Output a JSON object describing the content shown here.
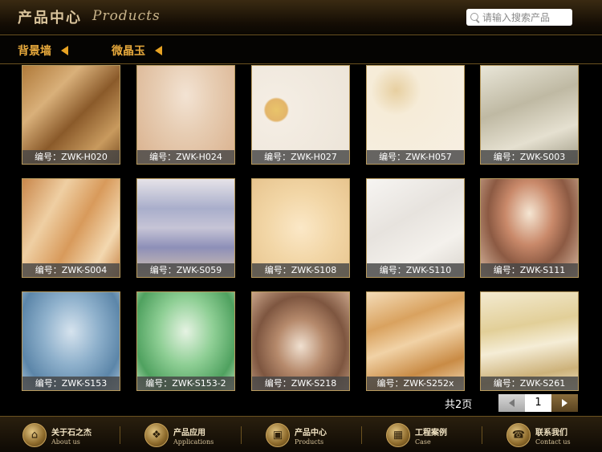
{
  "header": {
    "title_cn": "产品中心",
    "title_en": "Products",
    "search_placeholder": "请输入搜索产品"
  },
  "subnav": {
    "items": [
      {
        "label": "背景墙"
      },
      {
        "label": "微晶玉"
      }
    ]
  },
  "products": [
    {
      "code": "编号：ZWK-H020",
      "bg": "linear-gradient(135deg,#b07a3a 0%,#d9b07a 30%,#8a5a2a 55%,#c89a5e 80%,#7a4e22 100%)"
    },
    {
      "code": "编号：ZWK-H024",
      "bg": "radial-gradient(ellipse at 50% 30%,#f3e3d3 0%,#e7cdb3 40%,#d9b08c 100%)"
    },
    {
      "code": "编号：ZWK-H027",
      "bg": "radial-gradient(circle at 25% 45%,#e9c46a 0%,#e3b56a 12%,#f4ede3 14%,#ece4d8 100%)"
    },
    {
      "code": "编号：ZWK-H057",
      "bg": "radial-gradient(circle at 30% 25%,#e7cfa0 0%,#f6ecd8 25%,#f7efe3 100%)"
    },
    {
      "code": "编号：ZWK-S003",
      "bg": "linear-gradient(160deg,#e9e6d8 0%,#bfb9a3 40%,#e5e0d0 70%,#9f9a84 100%)"
    },
    {
      "code": "编号：ZWK-S004",
      "bg": "linear-gradient(120deg,#c9874b 0%,#efcfa3 30%,#d89a5b 55%,#f3d8b0 80%,#c88548 100%)"
    },
    {
      "code": "编号：ZWK-S059",
      "bg": "linear-gradient(180deg,#e6e3e8 0%,#a9aecb 30%,#c6c4d6 50%,#8d8fb8 70%,#d9c6b0 100%)"
    },
    {
      "code": "编号：ZWK-S108",
      "bg": "radial-gradient(ellipse at 50% 50%,#fbe8c7 0%,#f2d6a6 50%,#e7c48e 100%)"
    },
    {
      "code": "编号：ZWK-S110",
      "bg": "linear-gradient(150deg,#f7f5f2 0%,#e7e3de 40%,#f4f1ec 70%,#d9d4cd 100%)"
    },
    {
      "code": "编号：ZWK-S111",
      "bg": "radial-gradient(ellipse at 50% 35%,#f5e6d3 0%,#c9896a 35%,#8c5a43 60%,#d9b8a0 100%)"
    },
    {
      "code": "编号：ZWK-S153",
      "bg": "radial-gradient(ellipse at 50% 40%,#d6e3ee 0%,#8fb1cc 40%,#5c86a9 75%,#a9c3d9 100%)"
    },
    {
      "code": "编号：ZWK-S153-2",
      "bg": "radial-gradient(ellipse at 50% 40%,#e6f3e3 0%,#8fcf95 40%,#4fa15f 75%,#b8e0b9 100%)"
    },
    {
      "code": "编号：ZWK-S218",
      "bg": "radial-gradient(ellipse at 50% 55%,#f0e0d0 0%,#b68a6c 35%,#7e5640 65%,#c9a489 100%)"
    },
    {
      "code": "编号：ZWK-S252x",
      "bg": "linear-gradient(160deg,#f4dcb8 0%,#d9a25f 30%,#f1d2a6 50%,#c98b45 75%,#f3dcb9 100%)"
    },
    {
      "code": "编号：ZWK-S261",
      "bg": "linear-gradient(170deg,#f3ead0 0%,#e2cf98 35%,#f5edd6 55%,#cdb27a 80%,#efe3c3 100%)"
    }
  ],
  "pagination": {
    "total_text": "共2页",
    "current_page": "1"
  },
  "footer": {
    "items": [
      {
        "cn": "关于石之杰",
        "en": "About us",
        "icon": "home-icon",
        "glyph": "⌂"
      },
      {
        "cn": "产品应用",
        "en": "Applications",
        "icon": "applications-icon",
        "glyph": "❖"
      },
      {
        "cn": "产品中心",
        "en": "Products",
        "icon": "products-icon",
        "glyph": "▣"
      },
      {
        "cn": "工程案例",
        "en": "Case",
        "icon": "case-icon",
        "glyph": "▦"
      },
      {
        "cn": "联系我们",
        "en": "Contact us",
        "icon": "contact-icon",
        "glyph": "☎"
      }
    ]
  }
}
